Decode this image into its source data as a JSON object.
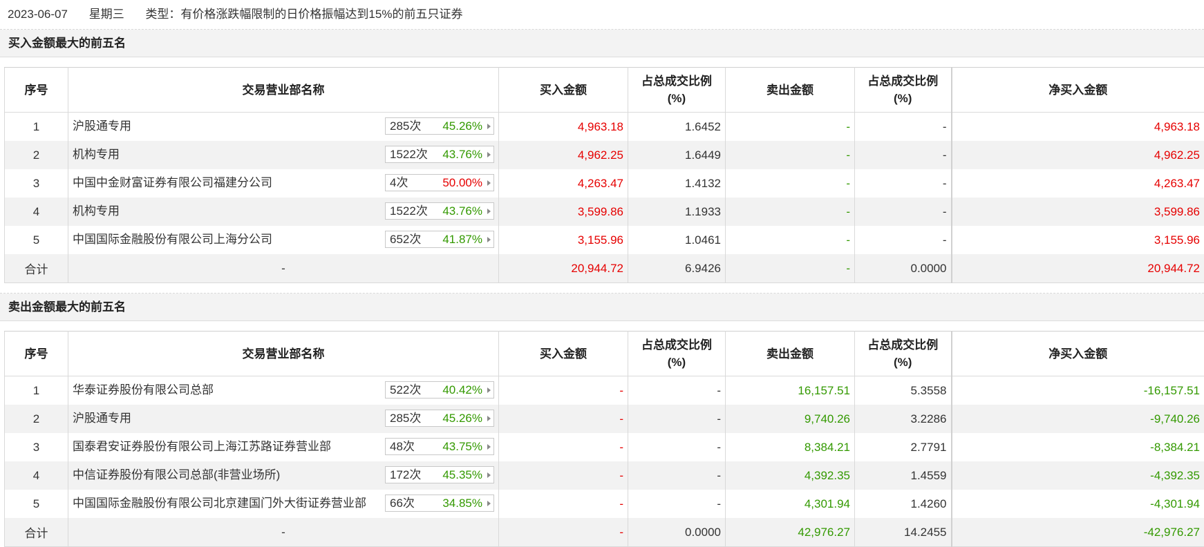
{
  "header": {
    "date": "2023-06-07",
    "weekday": "星期三",
    "type_text": "类型：有价格涨跌幅限制的日价格振幅达到15%的前五只证券"
  },
  "columns": {
    "seq": "序号",
    "name": "交易营业部名称",
    "buy": "买入金额",
    "buy_ratio_l1": "占总成交比例",
    "buy_ratio_l2": "(%)",
    "sell": "卖出金额",
    "sell_ratio_l1": "占总成交比例",
    "sell_ratio_l2": "(%)",
    "net": "净买入金额"
  },
  "buy_section": {
    "title": "买入金额最大的前五名",
    "rows": [
      {
        "seq": "1",
        "name": "沪股通专用",
        "count": "285次",
        "pct": "45.26%",
        "pct_color": "green",
        "buy": "4,963.18",
        "buy_ratio": "1.6452",
        "sell": "-",
        "sell_ratio": "-",
        "net": "4,963.18"
      },
      {
        "seq": "2",
        "name": "机构专用",
        "count": "1522次",
        "pct": "43.76%",
        "pct_color": "green",
        "buy": "4,962.25",
        "buy_ratio": "1.6449",
        "sell": "-",
        "sell_ratio": "-",
        "net": "4,962.25"
      },
      {
        "seq": "3",
        "name": "中国中金财富证券有限公司福建分公司",
        "count": "4次",
        "pct": "50.00%",
        "pct_color": "red",
        "buy": "4,263.47",
        "buy_ratio": "1.4132",
        "sell": "-",
        "sell_ratio": "-",
        "net": "4,263.47"
      },
      {
        "seq": "4",
        "name": "机构专用",
        "count": "1522次",
        "pct": "43.76%",
        "pct_color": "green",
        "buy": "3,599.86",
        "buy_ratio": "1.1933",
        "sell": "-",
        "sell_ratio": "-",
        "net": "3,599.86"
      },
      {
        "seq": "5",
        "name": "中国国际金融股份有限公司上海分公司",
        "count": "652次",
        "pct": "41.87%",
        "pct_color": "green",
        "buy": "3,155.96",
        "buy_ratio": "1.0461",
        "sell": "-",
        "sell_ratio": "-",
        "net": "3,155.96"
      }
    ],
    "total": {
      "label": "合计",
      "name": "-",
      "buy": "20,944.72",
      "buy_ratio": "6.9426",
      "sell": "-",
      "sell_ratio": "0.0000",
      "net": "20,944.72"
    }
  },
  "sell_section": {
    "title": "卖出金额最大的前五名",
    "rows": [
      {
        "seq": "1",
        "name": "华泰证券股份有限公司总部",
        "count": "522次",
        "pct": "40.42%",
        "pct_color": "green",
        "buy": "-",
        "buy_ratio": "-",
        "sell": "16,157.51",
        "sell_ratio": "5.3558",
        "net": "-16,157.51"
      },
      {
        "seq": "2",
        "name": "沪股通专用",
        "count": "285次",
        "pct": "45.26%",
        "pct_color": "green",
        "buy": "-",
        "buy_ratio": "-",
        "sell": "9,740.26",
        "sell_ratio": "3.2286",
        "net": "-9,740.26"
      },
      {
        "seq": "3",
        "name": "国泰君安证券股份有限公司上海江苏路证券营业部",
        "count": "48次",
        "pct": "43.75%",
        "pct_color": "green",
        "buy": "-",
        "buy_ratio": "-",
        "sell": "8,384.21",
        "sell_ratio": "2.7791",
        "net": "-8,384.21"
      },
      {
        "seq": "4",
        "name": "中信证券股份有限公司总部(非营业场所)",
        "count": "172次",
        "pct": "45.35%",
        "pct_color": "green",
        "buy": "-",
        "buy_ratio": "-",
        "sell": "4,392.35",
        "sell_ratio": "1.4559",
        "net": "-4,392.35"
      },
      {
        "seq": "5",
        "name": "中国国际金融股份有限公司北京建国门外大街证券营业部",
        "count": "66次",
        "pct": "34.85%",
        "pct_color": "green",
        "buy": "-",
        "buy_ratio": "-",
        "sell": "4,301.94",
        "sell_ratio": "1.4260",
        "net": "-4,301.94"
      }
    ],
    "total": {
      "label": "合计",
      "name": "-",
      "buy": "-",
      "buy_ratio": "0.0000",
      "sell": "42,976.27",
      "sell_ratio": "14.2455",
      "net": "-42,976.27"
    }
  },
  "colors": {
    "red": "#e60000",
    "green": "#339900"
  }
}
